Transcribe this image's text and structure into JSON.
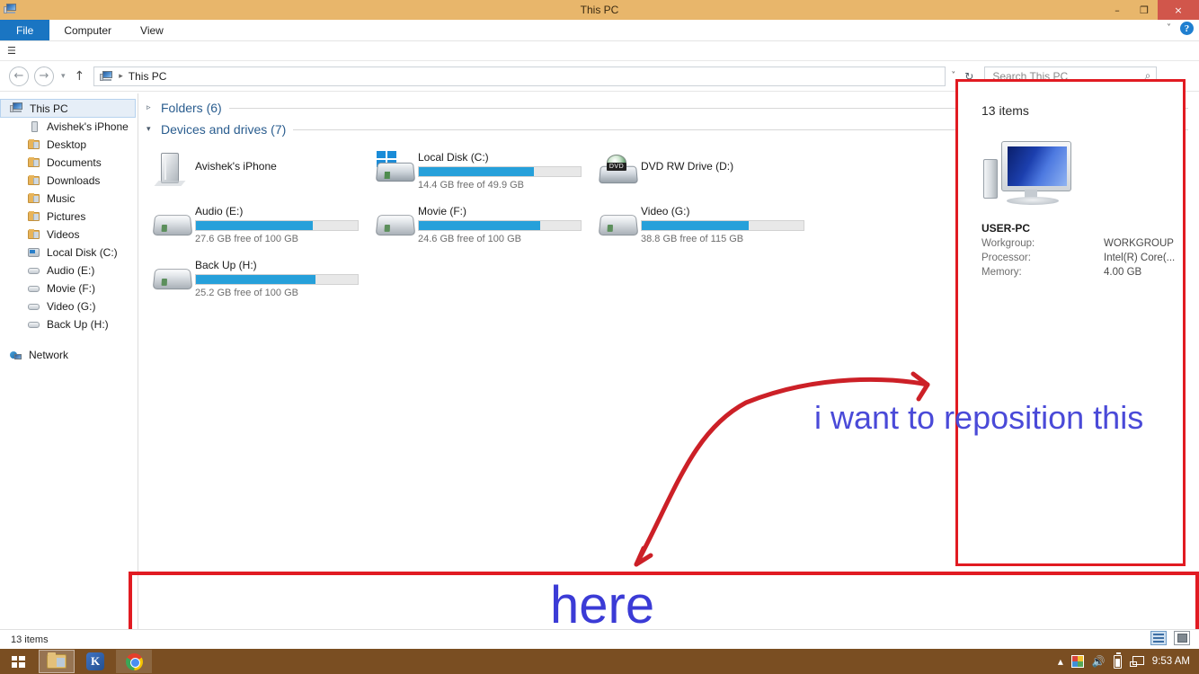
{
  "window": {
    "title": "This PC",
    "icon": "this-pc-icon",
    "controls": {
      "minimize": "–",
      "maximize": "❐",
      "close": "×"
    }
  },
  "ribbon": {
    "tabs": [
      {
        "label": "File",
        "active": true
      },
      {
        "label": "Computer",
        "active": false
      },
      {
        "label": "View",
        "active": false
      }
    ],
    "expand_chevron": "˅",
    "help_label": "?",
    "qat_glyph": "☰"
  },
  "addressbar": {
    "back": "←",
    "forward": "→",
    "recent": "▾",
    "up": "↑",
    "crumb_icon": "this-pc-icon",
    "crumb_separator": "▸",
    "crumb_text": "This PC",
    "dropdown_chevron": "˅",
    "refresh": "↻"
  },
  "search": {
    "placeholder": "Search This PC",
    "value": "",
    "icon": "⌕"
  },
  "sidebar": {
    "items": [
      {
        "label": "This PC",
        "icon": "this-pc-icon",
        "level": 0,
        "selected": true
      },
      {
        "label": "Avishek's iPhone",
        "icon": "phone-icon",
        "level": 1,
        "selected": false
      },
      {
        "label": "Desktop",
        "icon": "folder-icon",
        "level": 1,
        "selected": false
      },
      {
        "label": "Documents",
        "icon": "folder-icon",
        "level": 1,
        "selected": false
      },
      {
        "label": "Downloads",
        "icon": "folder-icon",
        "level": 1,
        "selected": false
      },
      {
        "label": "Music",
        "icon": "folder-icon",
        "level": 1,
        "selected": false
      },
      {
        "label": "Pictures",
        "icon": "folder-icon",
        "level": 1,
        "selected": false
      },
      {
        "label": "Videos",
        "icon": "folder-icon",
        "level": 1,
        "selected": false
      },
      {
        "label": "Local Disk (C:)",
        "icon": "local-disk-icon",
        "level": 1,
        "selected": false
      },
      {
        "label": "Audio (E:)",
        "icon": "hdd-icon",
        "level": 1,
        "selected": false
      },
      {
        "label": "Movie (F:)",
        "icon": "hdd-icon",
        "level": 1,
        "selected": false
      },
      {
        "label": "Video (G:)",
        "icon": "hdd-icon",
        "level": 1,
        "selected": false
      },
      {
        "label": "Back Up (H:)",
        "icon": "hdd-icon",
        "level": 1,
        "selected": false
      }
    ],
    "network": {
      "label": "Network",
      "icon": "network-icon"
    }
  },
  "content": {
    "groups": [
      {
        "label": "Folders (6)",
        "expanded": false,
        "triangle": "▹"
      },
      {
        "label": "Devices and drives (7)",
        "expanded": true,
        "triangle": "▾"
      }
    ],
    "drives": [
      {
        "name": "Avishek's iPhone",
        "icon": "iphone-icon",
        "has_bar": false,
        "sub": ""
      },
      {
        "name": "Local Disk (C:)",
        "icon": "windows-disk-icon",
        "has_bar": true,
        "fill_pct": 71,
        "sub": "14.4 GB free of 49.9 GB"
      },
      {
        "name": "DVD RW Drive (D:)",
        "icon": "dvd-drive-icon",
        "has_bar": false,
        "sub": ""
      },
      {
        "name": "Audio (E:)",
        "icon": "hdd-icon",
        "has_bar": true,
        "fill_pct": 72,
        "sub": "27.6 GB free of 100 GB"
      },
      {
        "name": "Movie (F:)",
        "icon": "hdd-icon",
        "has_bar": true,
        "fill_pct": 75,
        "sub": "24.6 GB free of 100 GB"
      },
      {
        "name": "Video (G:)",
        "icon": "hdd-icon",
        "has_bar": true,
        "fill_pct": 66,
        "sub": "38.8 GB free of 115 GB"
      },
      {
        "name": "Back Up (H:)",
        "icon": "hdd-icon",
        "has_bar": true,
        "fill_pct": 74,
        "sub": "25.2 GB free of 100 GB"
      }
    ]
  },
  "details_pane": {
    "items_count": "13 items",
    "preview_icon": "computer-icon",
    "computer_name": "USER-PC",
    "rows": [
      {
        "key": "Workgroup:",
        "value": "WORKGROUP"
      },
      {
        "key": "Processor:",
        "value": "Intel(R) Core(..."
      },
      {
        "key": "Memory:",
        "value": "4.00 GB"
      }
    ]
  },
  "statusbar": {
    "count": "13 items",
    "view_details": "details-view-icon",
    "view_large": "large-icons-view-icon"
  },
  "taskbar": {
    "start": "start-button",
    "apps": [
      {
        "name": "file-explorer",
        "icon": "folder-icon",
        "active": true
      },
      {
        "name": "kmplayer",
        "icon": "k-app-icon",
        "label": "K",
        "active": false
      },
      {
        "name": "chrome",
        "icon": "chrome-icon",
        "active": false
      }
    ],
    "tray": {
      "show_hidden": "▴",
      "antivirus_icon": "colored-app-icon",
      "volume_icon": "🔊",
      "battery_icon": "battery-icon",
      "network_icon": "network-icon",
      "clock": "9:53 AM"
    }
  },
  "annotations": {
    "reposition_text": "i want to reposition this",
    "here_text": "here",
    "box_color": "#e11b22",
    "text_color": "#4a4ad8",
    "arrow_color": "#cc2027"
  },
  "colors": {
    "titlebar": "#e8b66b",
    "taskbar": "#7a4e22",
    "file_tab": "#1a75c2",
    "group_header": "#2a5d8f",
    "drive_bar_fill": "#26a0da",
    "close_button": "#d1564b"
  }
}
